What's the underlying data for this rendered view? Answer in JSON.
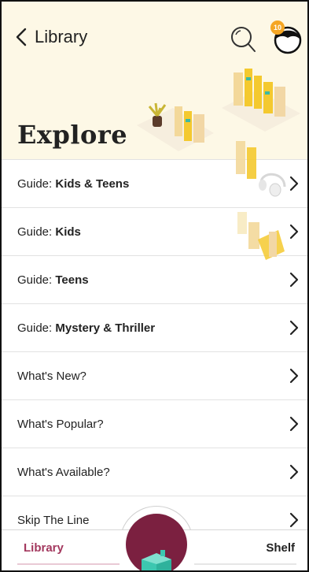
{
  "header": {
    "back_label": "Library",
    "title": "Explore",
    "notification_count": "10"
  },
  "list": {
    "items": [
      {
        "prefix": "Guide: ",
        "emphasis": "Kids & Teens"
      },
      {
        "prefix": "Guide: ",
        "emphasis": "Kids"
      },
      {
        "prefix": "Guide: ",
        "emphasis": "Teens"
      },
      {
        "prefix": "Guide: ",
        "emphasis": "Mystery & Thriller"
      },
      {
        "prefix": "What's New?",
        "emphasis": ""
      },
      {
        "prefix": "What's Popular?",
        "emphasis": ""
      },
      {
        "prefix": "What's Available?",
        "emphasis": ""
      },
      {
        "prefix": "Skip The Line",
        "emphasis": ""
      }
    ]
  },
  "bottom_nav": {
    "library_label": "Library",
    "shelf_label": "Shelf"
  },
  "colors": {
    "header_bg": "#fdf8e6",
    "accent": "#a3385e",
    "fab": "#7b2040",
    "badge": "#f5a623"
  },
  "icons": [
    "back-chevron-icon",
    "search-icon",
    "avatar-icon",
    "chevron-right-icon",
    "book-icon"
  ]
}
